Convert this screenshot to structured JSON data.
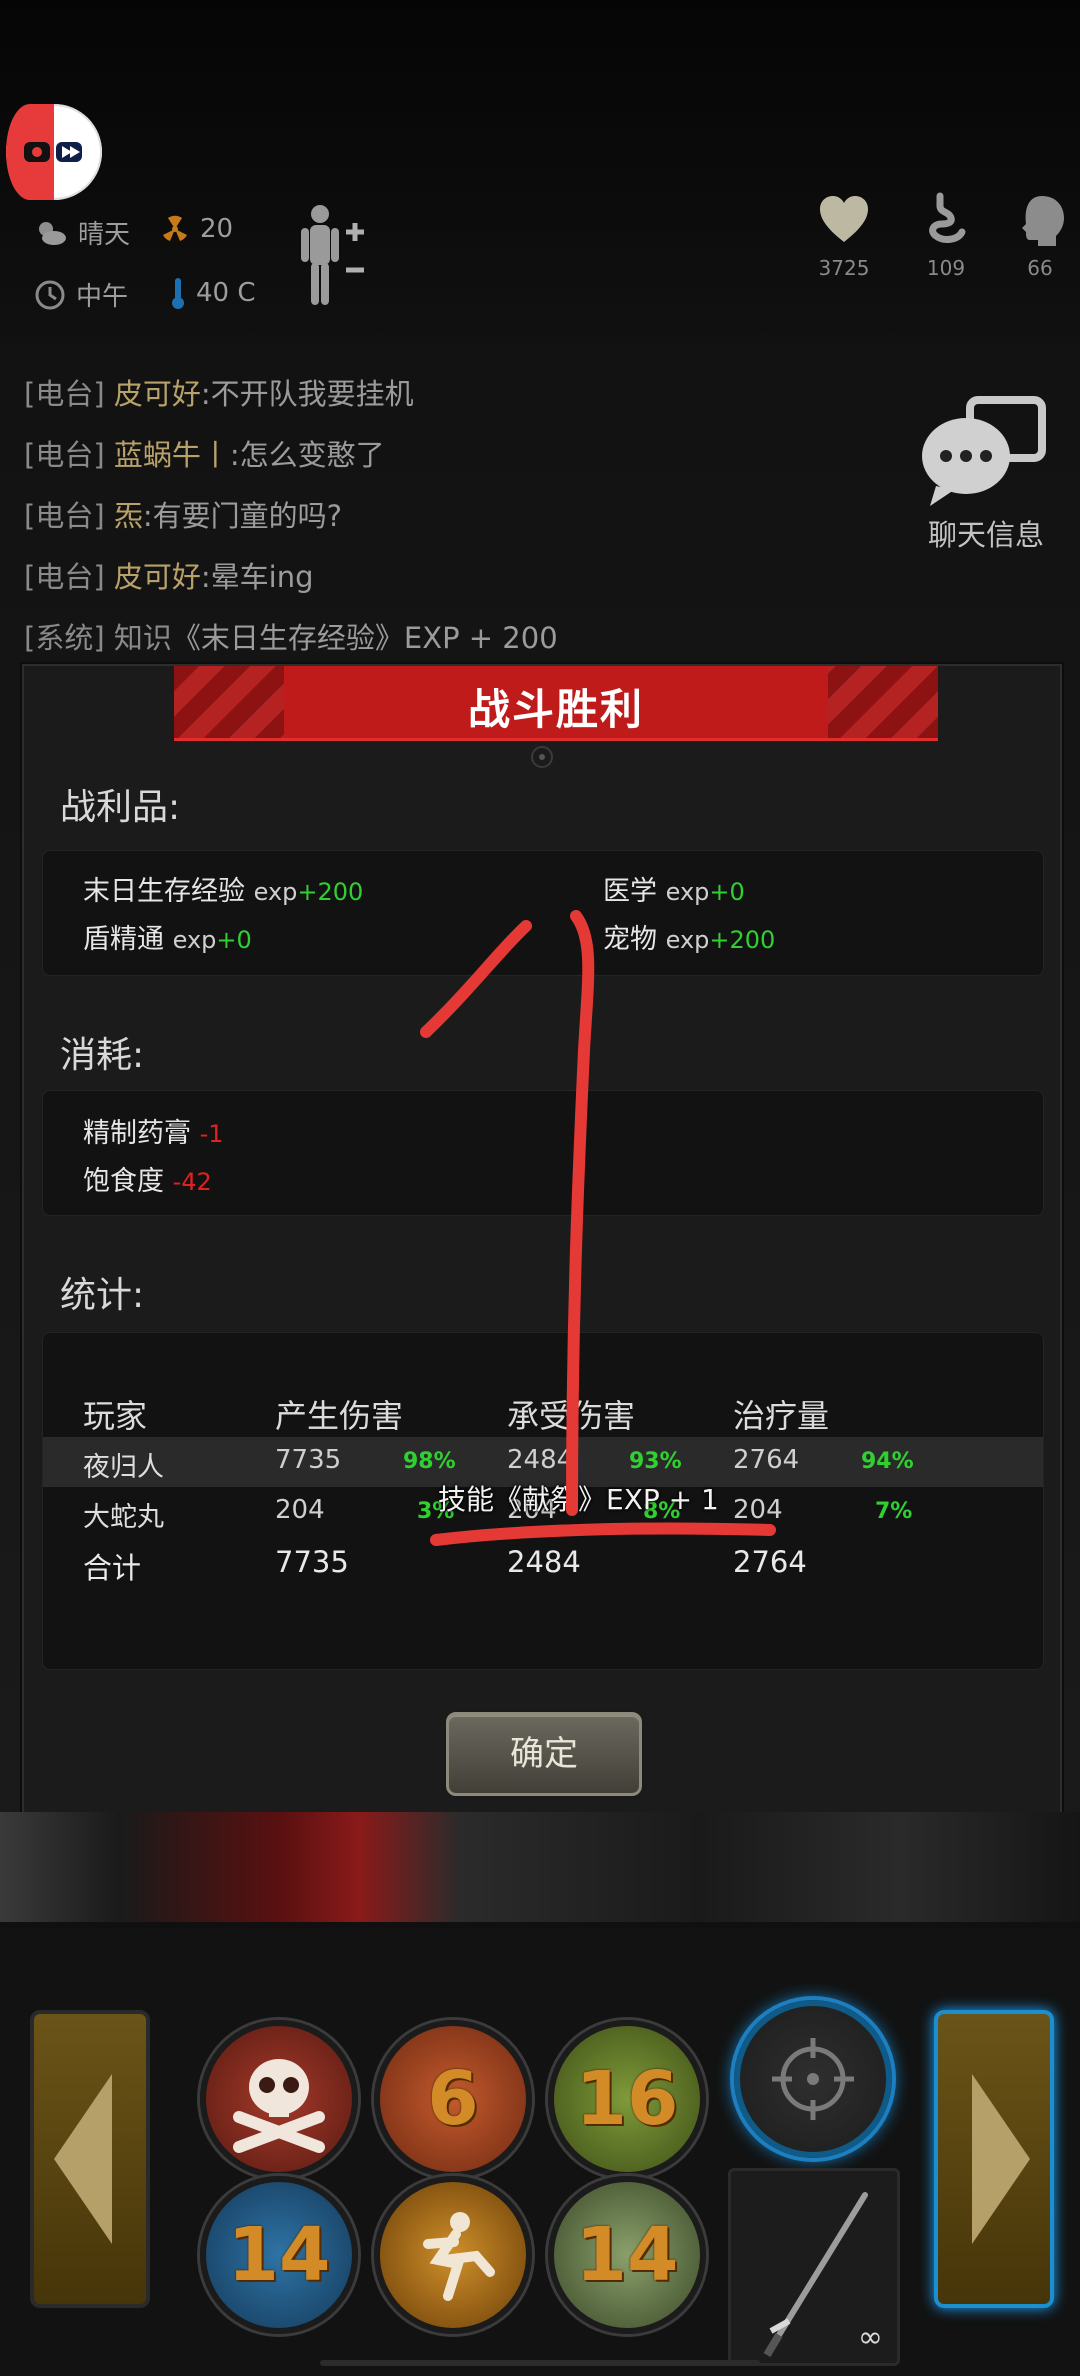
{
  "status": {
    "weather": "晴天",
    "radiation": "20",
    "time_of_day": "中午",
    "temperature": "40 C",
    "stats": [
      {
        "icon": "heart-icon",
        "value": "3725"
      },
      {
        "icon": "stomach-icon",
        "value": "109"
      },
      {
        "icon": "head-icon",
        "value": "66"
      }
    ]
  },
  "chat": {
    "lines": [
      {
        "tag": "[电台]",
        "name": "皮可好",
        "text": ":不开队我要挂机"
      },
      {
        "tag": "[电台]",
        "name": "蓝蜗牛丨",
        "text": ":怎么变憨了"
      },
      {
        "tag": "[电台]",
        "name": "炁",
        "text": ":有要门童的吗?"
      },
      {
        "tag": "[电台]",
        "name": "皮可好",
        "text": ":晕车ing"
      },
      {
        "tag": "[系统]",
        "name": "知识",
        "text": "《末日生存经验》EXP + 200"
      }
    ],
    "button_label": "聊天信息"
  },
  "dialog": {
    "title": "战斗胜利",
    "loot_title": "战利品:",
    "loot": [
      {
        "name": "末日生存经验",
        "unit": "exp",
        "delta": "+200"
      },
      {
        "name": "医学",
        "unit": "exp",
        "delta": "+0"
      },
      {
        "name": "盾精通",
        "unit": "exp",
        "delta": "+0"
      },
      {
        "name": "宠物",
        "unit": "exp",
        "delta": "+200"
      }
    ],
    "consume_title": "消耗:",
    "consume": [
      {
        "name": "精制药膏",
        "delta": "-1"
      },
      {
        "name": "饱食度",
        "delta": "-42"
      }
    ],
    "stats_title": "统计:",
    "stats_headers": [
      "玩家",
      "产生伤害",
      "承受伤害",
      "治疗量"
    ],
    "stats_rows": [
      {
        "player": "夜归人",
        "dealt": "7735",
        "dealt_pct": "98%",
        "taken": "2484",
        "taken_pct": "93%",
        "heal": "2764",
        "heal_pct": "94%"
      },
      {
        "player": "大蛇丸",
        "dealt": "204",
        "dealt_pct": "3%",
        "taken": "204",
        "taken_pct": "8%",
        "heal": "204",
        "heal_pct": "7%"
      }
    ],
    "total": {
      "label": "合计",
      "dealt": "7735",
      "taken": "2484",
      "heal": "2764"
    },
    "skill_toast": "技能《献祭》EXP + 1",
    "confirm_label": "确定"
  },
  "skills": {
    "skull_count": "",
    "six_count": "6",
    "sixteen_count": "16",
    "k14_count": "14",
    "heal14_count": "14",
    "weapon_ammo": "∞"
  },
  "colors": {
    "gain": "#2fd02f",
    "loss": "#e02121",
    "accent_red": "#c01b1b",
    "highlight_blue": "#1aa3ff"
  }
}
